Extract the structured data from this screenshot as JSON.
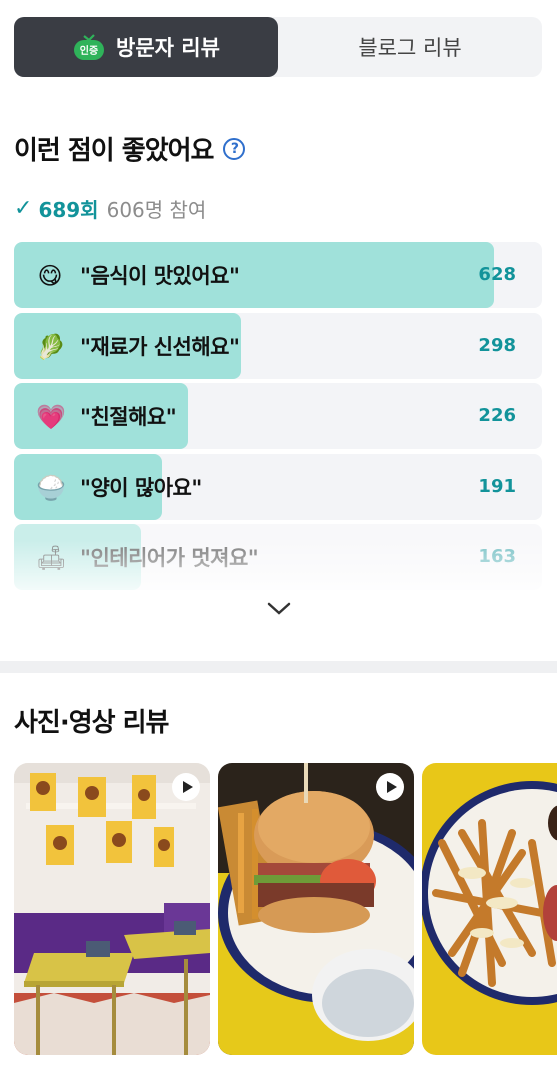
{
  "tabs": {
    "visitor_label": "방문자 리뷰",
    "blog_label": "블로그 리뷰",
    "badge_text": "인증"
  },
  "keywords_section": {
    "title": "이런 점이 좋았어요",
    "help_icon": "question-circle-icon",
    "check_icon": "checkmark-icon",
    "total_count": "689회",
    "participants": "606명 참여",
    "items": [
      {
        "emoji": "😋",
        "icon": "yummy-face-icon",
        "label": "\"음식이 맛있어요\"",
        "count": "628",
        "fill_fraction": 0.91
      },
      {
        "emoji": "🥬",
        "icon": "leaf-icon",
        "label": "\"재료가 신선해요\"",
        "count": "298",
        "fill_fraction": 0.43
      },
      {
        "emoji": "💗",
        "icon": "heart-icon",
        "label": "\"친절해요\"",
        "count": "226",
        "fill_fraction": 0.33
      },
      {
        "emoji": "🍚",
        "icon": "rice-bowl-icon",
        "label": "\"양이 많아요\"",
        "count": "191",
        "fill_fraction": 0.28
      },
      {
        "emoji": "🛋",
        "icon": "sofa-icon",
        "label": "\"인테리어가 멋져요\"",
        "count": "163",
        "fill_fraction": 0.24
      }
    ],
    "expand_icon": "chevron-down-icon"
  },
  "photo_section": {
    "title": "사진·영상 리뷰",
    "thumbnails": [
      {
        "kind": "video",
        "subject": "restaurant interior"
      },
      {
        "kind": "video",
        "subject": "burger plate"
      },
      {
        "kind": "photo",
        "subject": "loaded fries"
      }
    ]
  },
  "colors": {
    "accent": "#12939a",
    "bar_fill": "#a0e1da",
    "bar_track": "#f3f4f7",
    "active_tab": "#3a3d44",
    "badge_green": "#2fb35a"
  }
}
